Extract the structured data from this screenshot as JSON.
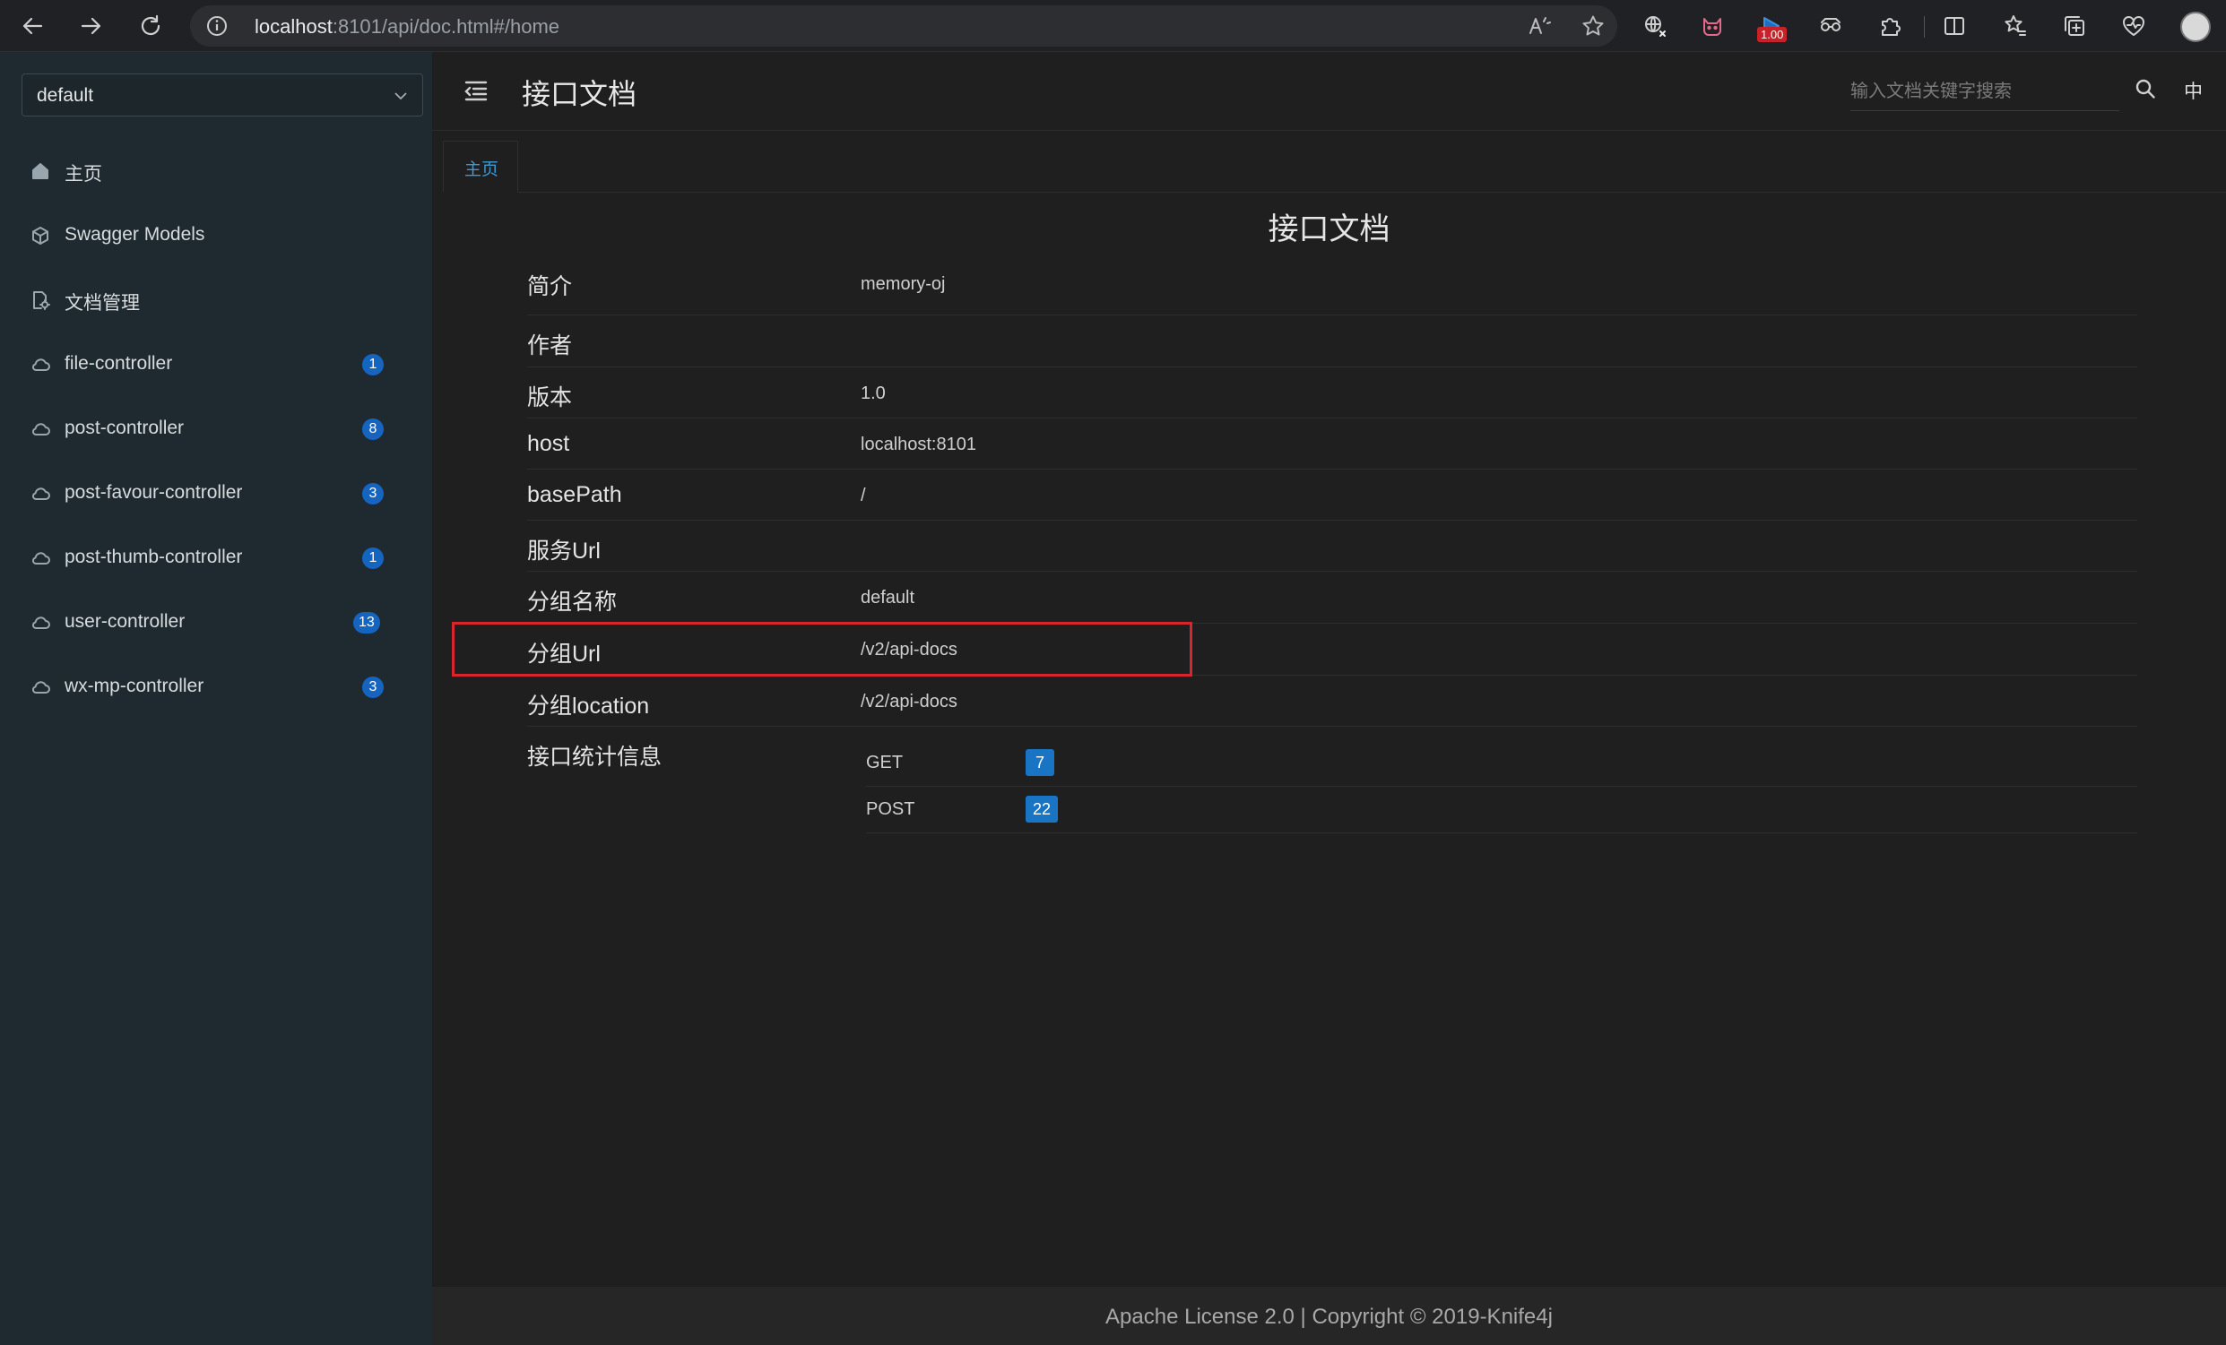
{
  "browser": {
    "url_host": "localhost",
    "url_rest": ":8101/api/doc.html#/home",
    "extension_badge": "1.00"
  },
  "sidebar": {
    "group_select_value": "default",
    "items": [
      {
        "label": "主页",
        "icon": "home-icon",
        "count": null
      },
      {
        "label": "Swagger Models",
        "icon": "models-icon",
        "count": null
      },
      {
        "label": "文档管理",
        "icon": "document-manage-icon",
        "count": null
      },
      {
        "label": "file-controller",
        "icon": "cloud-icon",
        "count": "1"
      },
      {
        "label": "post-controller",
        "icon": "cloud-icon",
        "count": "8"
      },
      {
        "label": "post-favour-controller",
        "icon": "cloud-icon",
        "count": "3"
      },
      {
        "label": "post-thumb-controller",
        "icon": "cloud-icon",
        "count": "1"
      },
      {
        "label": "user-controller",
        "icon": "cloud-icon",
        "count": "13"
      },
      {
        "label": "wx-mp-controller",
        "icon": "cloud-icon",
        "count": "3"
      }
    ]
  },
  "header": {
    "title": "接口文档",
    "search_placeholder": "输入文档关键字搜索",
    "language": "中"
  },
  "tabs": [
    {
      "label": "主页"
    }
  ],
  "doc": {
    "title": "接口文档",
    "rows": [
      {
        "key": "简介",
        "value": "memory-oj"
      },
      {
        "key": "作者",
        "value": ""
      },
      {
        "key": "版本",
        "value": "1.0"
      },
      {
        "key": "host",
        "value": "localhost:8101"
      },
      {
        "key": "basePath",
        "value": "/"
      },
      {
        "key": "服务Url",
        "value": ""
      },
      {
        "key": "分组名称",
        "value": "default"
      },
      {
        "key": "分组Url",
        "value": "/v2/api-docs"
      },
      {
        "key": "分组location",
        "value": "/v2/api-docs"
      },
      {
        "key": "接口统计信息",
        "value": ""
      }
    ],
    "stats": [
      {
        "method": "GET",
        "count": "7"
      },
      {
        "method": "POST",
        "count": "22"
      }
    ]
  },
  "footer": {
    "text": "Apache License 2.0 | Copyright © 2019-Knife4j"
  },
  "colors": {
    "accent": "#1a74c4",
    "badge": "#1565c0",
    "tab_active": "#3a9bd5",
    "highlight": "#d9262c",
    "sidebar_bg": "#1f2a30"
  }
}
